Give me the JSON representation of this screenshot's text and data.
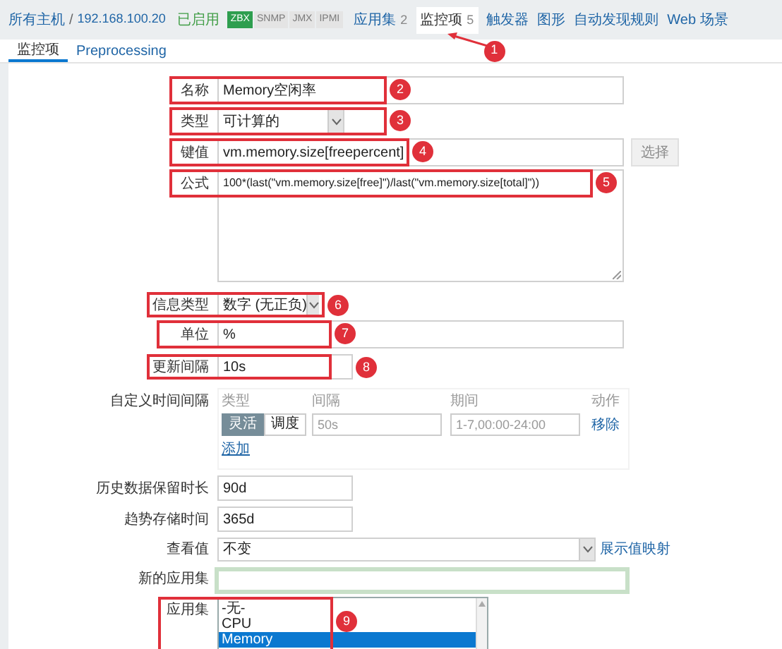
{
  "breadcrumb": {
    "root": "所有主机",
    "separator": "/",
    "host": "192.168.100.20",
    "status": "已启用"
  },
  "availability": [
    {
      "label": "ZBX",
      "on": true
    },
    {
      "label": "SNMP",
      "on": false
    },
    {
      "label": "JMX",
      "on": false
    },
    {
      "label": "IPMI",
      "on": false
    }
  ],
  "nav_tabs": [
    {
      "label": "应用集",
      "count": "2",
      "selected": false
    },
    {
      "label": "监控项",
      "count": "5",
      "selected": true,
      "annotation": "1"
    },
    {
      "label": "触发器",
      "selected": false
    },
    {
      "label": "图形",
      "selected": false
    },
    {
      "label": "自动发现规则",
      "selected": false
    },
    {
      "label": "Web 场景",
      "selected": false
    }
  ],
  "sub_tabs": [
    {
      "label": "监控项",
      "selected": true
    },
    {
      "label": "Preprocessing",
      "selected": false
    }
  ],
  "form": {
    "rows": [
      {
        "kind": "text",
        "label": "名称",
        "value": "Memory空闲率",
        "annotation": "2"
      },
      {
        "kind": "select",
        "label": "类型",
        "value": "可计算的",
        "annotation": "3"
      },
      {
        "kind": "text_button",
        "label": "键值",
        "value": "vm.memory.size[freepercent]",
        "button": "选择",
        "annotation": "4"
      },
      {
        "kind": "textarea",
        "label": "公式",
        "value": "100*(last(\"vm.memory.size[free]\")/last(\"vm.memory.size[total]\"))",
        "annotation": "5"
      },
      {
        "kind": "select_narrow",
        "label": "信息类型",
        "value": "数字 (无正负)",
        "annotation": "6"
      },
      {
        "kind": "text",
        "label": "单位",
        "value": "%",
        "annotation": "7"
      },
      {
        "kind": "short_text",
        "label": "更新间隔",
        "value": "10s",
        "annotation": "8"
      },
      {
        "kind": "intervals",
        "label": "自定义时间间隔",
        "headers": [
          "类型",
          "间隔",
          "期间",
          "动作"
        ],
        "modes": [
          {
            "label": "灵活",
            "selected": true
          },
          {
            "label": "调度",
            "selected": false
          }
        ],
        "interval_placeholder": "50s",
        "period_placeholder": "1-7,00:00-24:00",
        "action": "移除",
        "add": "添加"
      },
      {
        "kind": "short_text",
        "label": "历史数据保留时长",
        "value": "90d"
      },
      {
        "kind": "short_text",
        "label": "趋势存储时间",
        "value": "365d"
      },
      {
        "kind": "select_link",
        "label": "查看值",
        "value": "不变",
        "link": "展示值映射"
      },
      {
        "kind": "new_text",
        "label": "新的应用集"
      },
      {
        "kind": "listbox",
        "label": "应用集",
        "options": [
          {
            "label": "-无-",
            "selected": false
          },
          {
            "label": "CPU",
            "selected": false
          },
          {
            "label": "Memory",
            "selected": true
          }
        ],
        "annotation": "9"
      }
    ]
  }
}
